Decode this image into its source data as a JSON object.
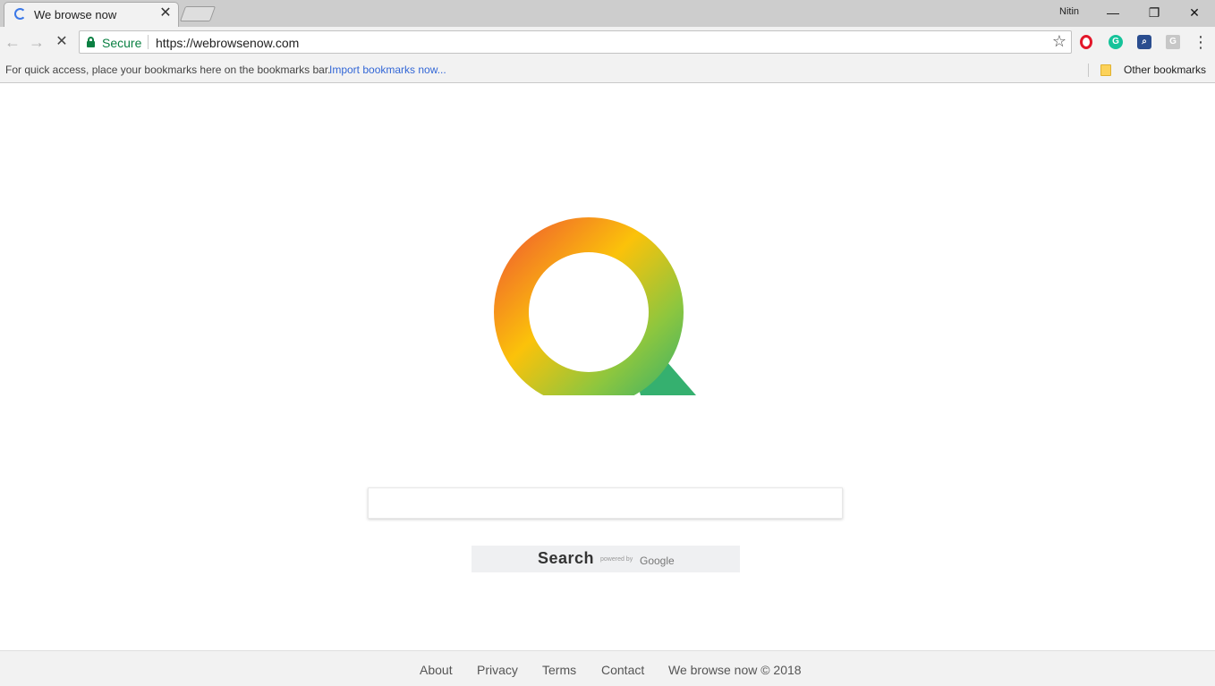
{
  "browser": {
    "tab_title": "We browse now",
    "tab_close": "✕",
    "profile_name": "Nitin",
    "window_controls": {
      "minimize": "—",
      "restore": "❐",
      "close": "✕"
    },
    "nav": {
      "back": "←",
      "forward": "→",
      "reload": "✕"
    },
    "address": {
      "secure_label": "Secure",
      "url": "https://webrowsenow.com"
    },
    "bookmark_star": "☆",
    "extensions": {
      "opera": "",
      "grammarly": "G",
      "search": "⌕",
      "g": "G"
    },
    "menu": "⋮",
    "bookmarks_bar": {
      "hint": "For quick access, place your bookmarks here on the bookmarks bar.",
      "import_link": "Import bookmarks now...",
      "other": "Other bookmarks"
    }
  },
  "page": {
    "logo_icon": "q-logo-icon",
    "search": {
      "input_value": "",
      "button_label": "Search",
      "powered_by": "powered by",
      "powered_brand": "Google"
    },
    "footer": {
      "links": [
        "About",
        "Privacy",
        "Terms",
        "Contact"
      ],
      "copyright": "We browse now © 2018"
    }
  },
  "colors": {
    "accent_green": "#0b8043",
    "link_blue": "#3367d6",
    "logo_red": "#f05a32",
    "logo_yellow": "#fbc20a",
    "logo_green": "#3bb36a"
  }
}
